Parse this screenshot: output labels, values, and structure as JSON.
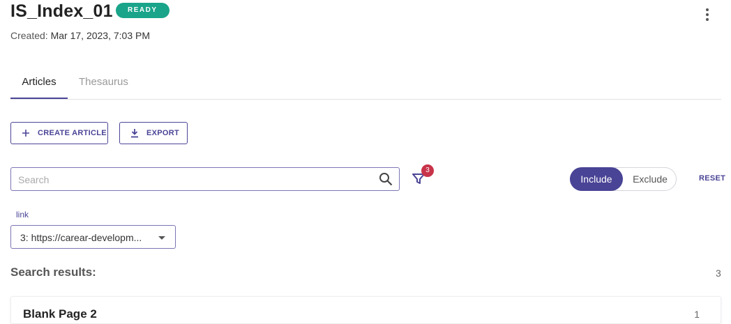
{
  "header": {
    "title": "IS_Index_01",
    "status_badge": "READY",
    "created_label": "Created:",
    "created_value": "Mar 17, 2023, 7:03 PM"
  },
  "tabs": [
    {
      "label": "Articles",
      "active": true
    },
    {
      "label": "Thesaurus",
      "active": false
    }
  ],
  "toolbar": {
    "create_label": "CREATE ARTICLE",
    "export_label": "EXPORT"
  },
  "search": {
    "placeholder": "Search",
    "value": ""
  },
  "filter": {
    "count": "3"
  },
  "include_toggle": {
    "include_label": "Include",
    "exclude_label": "Exclude",
    "selected": "Include"
  },
  "reset_label": "RESET",
  "link_filter": {
    "label": "link",
    "selected_value": "3: https://carear-developm..."
  },
  "results": {
    "title": "Search results:",
    "count": "3",
    "items": [
      {
        "title": "Blank Page 2",
        "number": "1"
      }
    ]
  },
  "colors": {
    "accent": "#4a4496",
    "ready_badge": "#1aa48a",
    "filter_badge": "#c8334a"
  }
}
